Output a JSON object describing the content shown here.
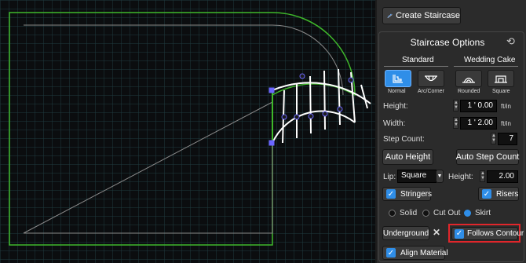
{
  "header": {
    "create_staircase_label": "Create Staircase"
  },
  "options": {
    "title": "Staircase Options",
    "groups": {
      "standard": "Standard",
      "wedding_cake": "Wedding Cake"
    },
    "styles": [
      {
        "label": "Normal",
        "icon": "normal-stairs-icon",
        "selected": true
      },
      {
        "label": "Arc/Corner",
        "icon": "arc-corner-stairs-icon",
        "selected": false
      },
      {
        "label": "Rounded",
        "icon": "rounded-stairs-icon",
        "selected": false
      },
      {
        "label": "Square",
        "icon": "square-stairs-icon",
        "selected": false
      }
    ],
    "height": {
      "label": "Height:",
      "value": "1 ' 0.00",
      "unit": "ft/in"
    },
    "width": {
      "label": "Width:",
      "value": "1 ' 2.00",
      "unit": "ft/in"
    },
    "step_count": {
      "label": "Step Count:",
      "value": "7"
    },
    "auto_height_label": "Auto Height",
    "auto_step_count_label": "Auto Step Count",
    "lip": {
      "label": "Lip:",
      "value": "Square"
    },
    "lip_height": {
      "label": "Height:",
      "value": "2.00"
    },
    "stringers": {
      "label": "Stringers",
      "checked": true
    },
    "risers": {
      "label": "Risers",
      "checked": true
    },
    "radio_options": [
      {
        "label": "Solid",
        "selected": false
      },
      {
        "label": "Cut Out",
        "selected": false
      },
      {
        "label": "Skirt",
        "selected": true
      }
    ],
    "underground_label": "Underground",
    "follows_contour": {
      "label": "Follows Contour",
      "checked": true
    },
    "align_material": {
      "label": "Align Material",
      "checked": true
    }
  },
  "colors": {
    "accent": "#2f8ee8",
    "highlight": "#e0262b",
    "wall": "#3fb82b",
    "grid": "#1f3a3f"
  }
}
